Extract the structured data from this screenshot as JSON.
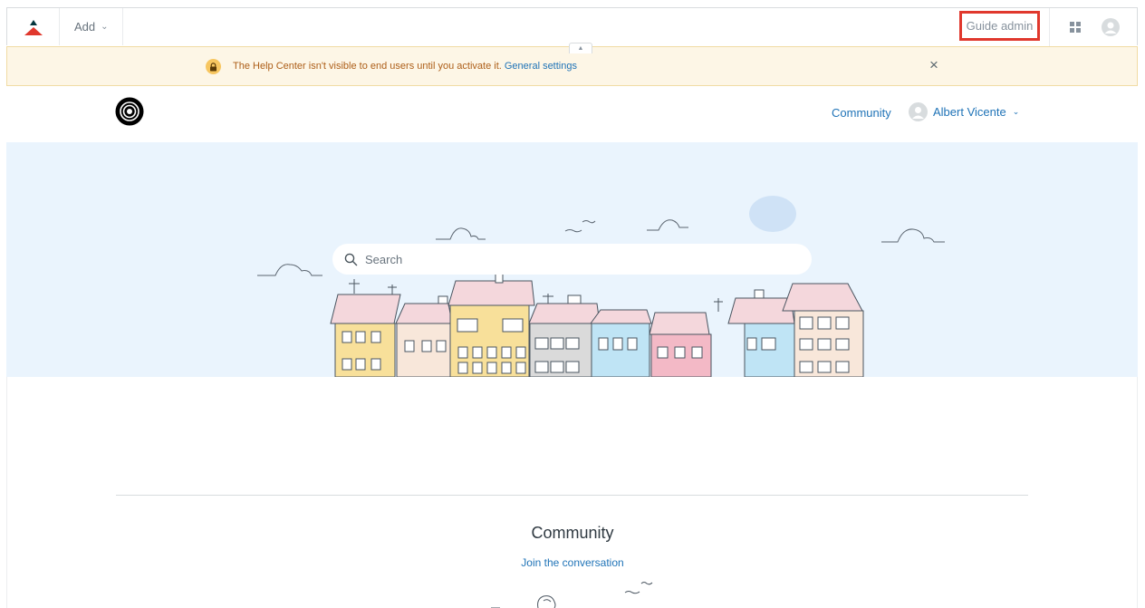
{
  "admin_bar": {
    "add_label": "Add",
    "guide_admin_label": "Guide admin"
  },
  "notice": {
    "message": "The Help Center isn't visible to end users until you activate it.",
    "link_label": "General settings"
  },
  "help_center": {
    "nav": {
      "community_label": "Community",
      "user_name": "Albert Vicente"
    },
    "search": {
      "placeholder": "Search"
    },
    "community_section": {
      "title": "Community",
      "link_label": "Join the conversation"
    }
  },
  "colors": {
    "brand_red": "#e0382d",
    "link_blue": "#1f73b7",
    "notice_bg": "#fdf6e6",
    "hero_bg": "#eaf4fd"
  }
}
